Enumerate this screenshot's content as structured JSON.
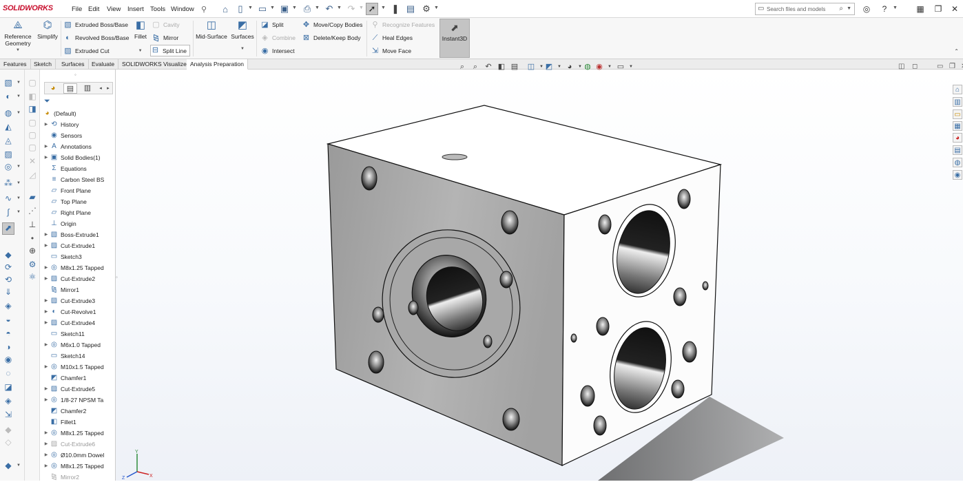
{
  "app": {
    "logo": "SOLIDWORKS"
  },
  "menu": {
    "items": [
      "File",
      "Edit",
      "View",
      "Insert",
      "Tools",
      "Window"
    ]
  },
  "search": {
    "placeholder": "Search files and models"
  },
  "ribbon": {
    "reference_geometry": "Reference Geometry",
    "simplify": "Simplify",
    "extruded_boss": "Extruded Boss/Base",
    "revolved_boss": "Revolved Boss/Base",
    "extruded_cut": "Extruded Cut",
    "fillet": "Fillet",
    "cavity": "Cavity",
    "mirror": "Mirror",
    "split_line": "Split Line",
    "mid_surface": "Mid-Surface",
    "surfaces": "Surfaces",
    "split": "Split",
    "combine": "Combine",
    "intersect": "Intersect",
    "move_copy": "Move/Copy Bodies",
    "delete_keep": "Delete/Keep Body",
    "recognize": "Recognize Features",
    "heal_edges": "Heal Edges",
    "move_face": "Move Face",
    "instant3d": "Instant3D"
  },
  "tabs": [
    "Features",
    "Sketch",
    "Surfaces",
    "Evaluate",
    "SOLIDWORKS Visualize",
    "Analysis Preparation"
  ],
  "tree": {
    "root": "(Default)",
    "nodes": [
      {
        "label": "History",
        "icon": "history-icon",
        "expand": true,
        "dim": false
      },
      {
        "label": "Sensors",
        "icon": "sensor-icon",
        "expand": false,
        "dim": false
      },
      {
        "label": "Annotations",
        "icon": "annotation-icon",
        "expand": true,
        "dim": false
      },
      {
        "label": "Solid Bodies(1)",
        "icon": "solid-body-icon",
        "expand": true,
        "dim": false
      },
      {
        "label": "Equations",
        "icon": "equation-icon",
        "expand": false,
        "dim": false
      },
      {
        "label": "Carbon Steel BS",
        "icon": "material-icon",
        "expand": false,
        "dim": false
      },
      {
        "label": "Front Plane",
        "icon": "plane-icon",
        "expand": false,
        "dim": false
      },
      {
        "label": "Top Plane",
        "icon": "plane-icon",
        "expand": false,
        "dim": false
      },
      {
        "label": "Right Plane",
        "icon": "plane-icon",
        "expand": false,
        "dim": false
      },
      {
        "label": "Origin",
        "icon": "origin-icon",
        "expand": false,
        "dim": false
      },
      {
        "label": "Boss-Extrude1",
        "icon": "boss-extrude-icon",
        "expand": true,
        "dim": false
      },
      {
        "label": "Cut-Extrude1",
        "icon": "cut-extrude-icon",
        "expand": true,
        "dim": false
      },
      {
        "label": "Sketch3",
        "icon": "sketch-icon",
        "expand": false,
        "dim": false
      },
      {
        "label": "M8x1.25 Tapped",
        "icon": "hole-icon",
        "expand": true,
        "dim": false
      },
      {
        "label": "Cut-Extrude2",
        "icon": "cut-extrude-icon",
        "expand": true,
        "dim": false
      },
      {
        "label": "Mirror1",
        "icon": "mirror-icon",
        "expand": false,
        "dim": false
      },
      {
        "label": "Cut-Extrude3",
        "icon": "cut-extrude-icon",
        "expand": true,
        "dim": false
      },
      {
        "label": "Cut-Revolve1",
        "icon": "cut-revolve-icon",
        "expand": true,
        "dim": false
      },
      {
        "label": "Cut-Extrude4",
        "icon": "cut-extrude-icon",
        "expand": true,
        "dim": false
      },
      {
        "label": "Sketch11",
        "icon": "sketch-icon",
        "expand": false,
        "dim": false
      },
      {
        "label": "M6x1.0 Tapped",
        "icon": "hole-icon",
        "expand": true,
        "dim": false
      },
      {
        "label": "Sketch14",
        "icon": "sketch-icon",
        "expand": false,
        "dim": false
      },
      {
        "label": "M10x1.5 Tapped",
        "icon": "hole-icon",
        "expand": true,
        "dim": false
      },
      {
        "label": "Chamfer1",
        "icon": "chamfer-icon",
        "expand": false,
        "dim": false
      },
      {
        "label": "Cut-Extrude5",
        "icon": "cut-extrude-icon",
        "expand": true,
        "dim": false
      },
      {
        "label": "1/8-27 NPSM Ta",
        "icon": "hole-icon",
        "expand": true,
        "dim": false
      },
      {
        "label": "Chamfer2",
        "icon": "chamfer-icon",
        "expand": false,
        "dim": false
      },
      {
        "label": "Fillet1",
        "icon": "fillet-icon",
        "expand": false,
        "dim": false
      },
      {
        "label": "M8x1.25 Tapped",
        "icon": "hole-icon",
        "expand": true,
        "dim": false
      },
      {
        "label": "Cut-Extrude6",
        "icon": "cut-extrude-icon",
        "expand": true,
        "dim": true
      },
      {
        "label": "Ø10.0mm Dowel",
        "icon": "hole-icon",
        "expand": true,
        "dim": false
      },
      {
        "label": "M8x1.25 Tapped",
        "icon": "hole-icon",
        "expand": true,
        "dim": false
      },
      {
        "label": "Mirror2",
        "icon": "mirror-icon",
        "expand": false,
        "dim": true
      }
    ]
  },
  "triad": {
    "x": "X",
    "y": "Y",
    "z": "Z"
  },
  "colors": {
    "brand": "#c8102e",
    "accent": "#3a6ea5",
    "instant3d_bg": "#c4c4c4"
  }
}
